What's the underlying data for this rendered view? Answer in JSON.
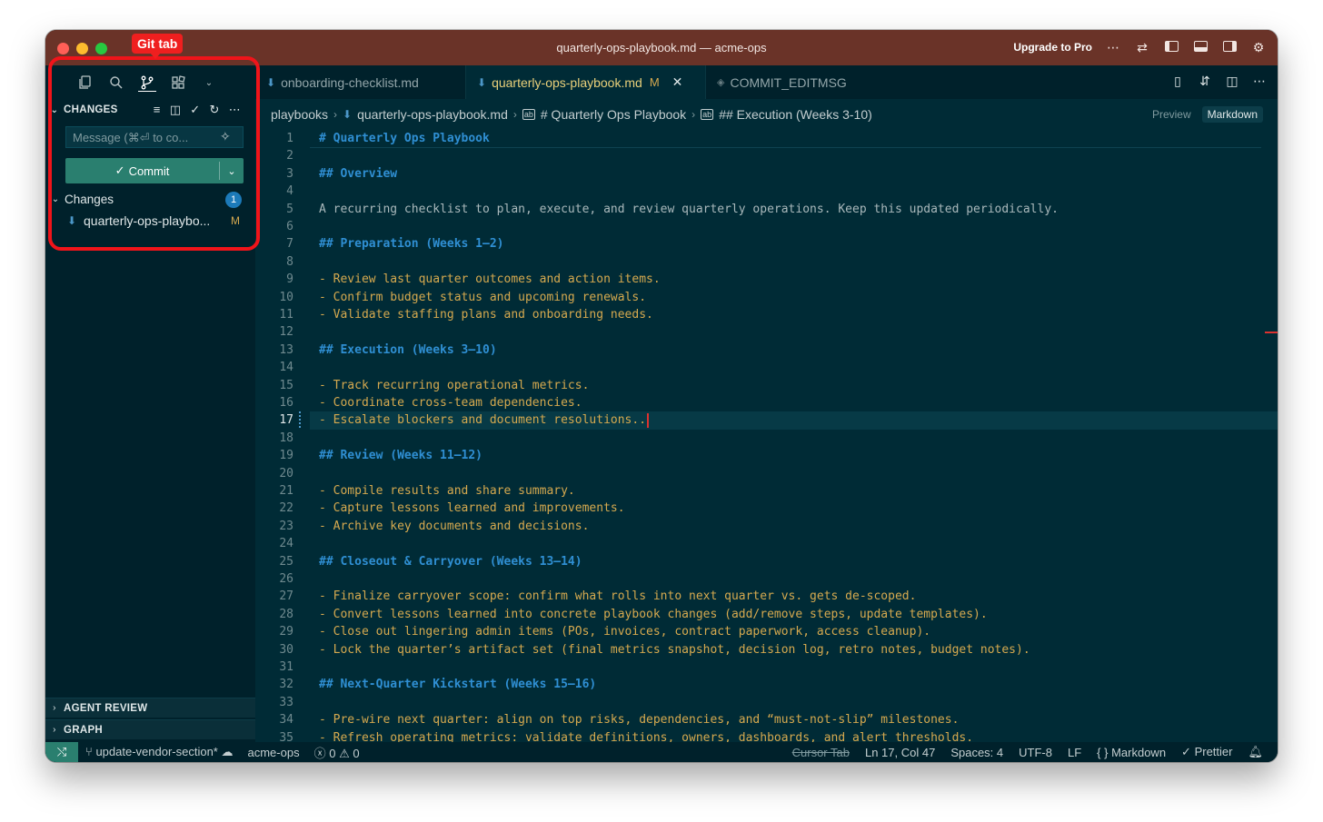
{
  "window": {
    "title": "quarterly-ops-playbook.md — acme-ops",
    "upgrade_label": "Upgrade to Pro"
  },
  "callout": {
    "label": "Git tab"
  },
  "sidebar": {
    "changes_header": "CHANGES",
    "message_placeholder": "Message (⌘⏎ to co...",
    "commit_label": "Commit",
    "changes_group_label": "Changes",
    "changes_count": "1",
    "file": {
      "name": "quarterly-ops-playbo...",
      "status": "M"
    },
    "sections": [
      "AGENT REVIEW",
      "GRAPH"
    ]
  },
  "tabs": [
    {
      "label": "onboarding-checklist.md",
      "modified": "",
      "active": false
    },
    {
      "label": "quarterly-ops-playbook.md",
      "modified": "M",
      "active": true
    },
    {
      "label": "COMMIT_EDITMSG",
      "modified": "",
      "active": false
    }
  ],
  "breadcrumbs": [
    "playbooks",
    "quarterly-ops-playbook.md",
    "# Quarterly Ops Playbook",
    "## Execution (Weeks 3-10)"
  ],
  "view_toggle": {
    "preview": "Preview",
    "markdown": "Markdown"
  },
  "editor": {
    "current_line": 17,
    "lines": [
      {
        "n": "1",
        "text": "# Quarterly Ops Playbook",
        "kind": "heading"
      },
      {
        "n": "2",
        "text": "",
        "kind": "plain"
      },
      {
        "n": "3",
        "text": "## Overview",
        "kind": "heading"
      },
      {
        "n": "4",
        "text": "",
        "kind": "plain"
      },
      {
        "n": "5",
        "text": "A recurring checklist to plan, execute, and review quarterly operations. Keep this updated periodically.",
        "kind": "plain"
      },
      {
        "n": "6",
        "text": "",
        "kind": "plain"
      },
      {
        "n": "7",
        "text": "## Preparation (Weeks 1–2)",
        "kind": "heading"
      },
      {
        "n": "8",
        "text": "",
        "kind": "plain"
      },
      {
        "n": "9",
        "text": "- Review last quarter outcomes and action items.",
        "kind": "list"
      },
      {
        "n": "10",
        "text": "- Confirm budget status and upcoming renewals.",
        "kind": "list"
      },
      {
        "n": "11",
        "text": "- Validate staffing plans and onboarding needs.",
        "kind": "list"
      },
      {
        "n": "12",
        "text": "",
        "kind": "plain"
      },
      {
        "n": "13",
        "text": "## Execution (Weeks 3–10)",
        "kind": "heading"
      },
      {
        "n": "14",
        "text": "",
        "kind": "plain"
      },
      {
        "n": "15",
        "text": "- Track recurring operational metrics.",
        "kind": "list"
      },
      {
        "n": "16",
        "text": "- Coordinate cross-team dependencies.",
        "kind": "list"
      },
      {
        "n": "17",
        "text": "- Escalate blockers and document resolutions..",
        "kind": "list"
      },
      {
        "n": "18",
        "text": "",
        "kind": "plain"
      },
      {
        "n": "19",
        "text": "## Review (Weeks 11–12)",
        "kind": "heading"
      },
      {
        "n": "20",
        "text": "",
        "kind": "plain"
      },
      {
        "n": "21",
        "text": "- Compile results and share summary.",
        "kind": "list"
      },
      {
        "n": "22",
        "text": "- Capture lessons learned and improvements.",
        "kind": "list"
      },
      {
        "n": "23",
        "text": "- Archive key documents and decisions.",
        "kind": "list"
      },
      {
        "n": "24",
        "text": "",
        "kind": "plain"
      },
      {
        "n": "25",
        "text": "## Closeout & Carryover (Weeks 13–14)",
        "kind": "heading"
      },
      {
        "n": "26",
        "text": "",
        "kind": "plain"
      },
      {
        "n": "27",
        "text": "- Finalize carryover scope: confirm what rolls into next quarter vs. gets de-scoped.",
        "kind": "list"
      },
      {
        "n": "28",
        "text": "- Convert lessons learned into concrete playbook changes (add/remove steps, update templates).",
        "kind": "list"
      },
      {
        "n": "29",
        "text": "- Close out lingering admin items (POs, invoices, contract paperwork, access cleanup).",
        "kind": "list"
      },
      {
        "n": "30",
        "text": "- Lock the quarter’s artifact set (final metrics snapshot, decision log, retro notes, budget notes).",
        "kind": "list"
      },
      {
        "n": "31",
        "text": "",
        "kind": "plain"
      },
      {
        "n": "32",
        "text": "## Next-Quarter Kickstart (Weeks 15–16)",
        "kind": "heading"
      },
      {
        "n": "33",
        "text": "",
        "kind": "plain"
      },
      {
        "n": "34",
        "text": "- Pre-wire next quarter: align on top risks, dependencies, and “must-not-slip” milestones.",
        "kind": "list"
      },
      {
        "n": "35",
        "text": "- Refresh operating metrics: validate definitions, owners, dashboards, and alert thresholds.",
        "kind": "list"
      }
    ]
  },
  "statusbar": {
    "branch": "update-vendor-section*",
    "workspace": "acme-ops",
    "errors": "0",
    "warnings": "0",
    "cursor_tab": "Cursor Tab",
    "position": "Ln 17, Col 47",
    "spaces": "Spaces: 4",
    "encoding": "UTF-8",
    "eol": "LF",
    "language": "Markdown",
    "formatter": "Prettier"
  },
  "colors": {
    "titlebar": "#6a3328",
    "editor_bg": "#002b36",
    "sidebar_bg": "#00212b",
    "accent": "#2a7f6f",
    "heading": "#2f8fd3",
    "list": "#d5a94f",
    "highlight": "#f0141a"
  },
  "icons": [
    "explorer-icon",
    "search-icon",
    "source-control-icon",
    "extensions-icon",
    "chevron-down-icon",
    "sparkle-icon",
    "branch-icon",
    "sync-icon",
    "bell-icon"
  ]
}
